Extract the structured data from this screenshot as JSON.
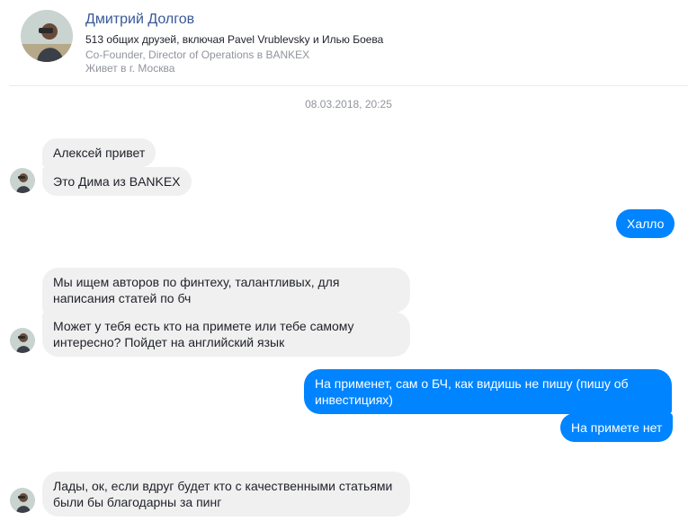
{
  "profile": {
    "name": "Дмитрий Долгов",
    "mutual_friends": "513 общих друзей, включая Pavel Vrublevsky и Илью Боева",
    "job": "Co-Founder, Director of Operations в BANKEX",
    "city": "Живет в г. Москва"
  },
  "conversation": {
    "timestamp": "08.03.2018, 20:25",
    "messages": [
      {
        "text": "Алексей привет",
        "direction": "incoming"
      },
      {
        "text": "Это Дима из BANKEX",
        "direction": "incoming"
      },
      {
        "text": "Халло",
        "direction": "outgoing"
      },
      {
        "text": "Мы ищем авторов по финтеху, талантливых, для написания статей по бч",
        "direction": "incoming"
      },
      {
        "text": "Может у тебя есть кто на примете или тебе самому интересно?  Пойдет на английский язык",
        "direction": "incoming"
      },
      {
        "text": "На применет, сам о БЧ, как видишь не пишу (пишу об инвестициях)",
        "direction": "outgoing"
      },
      {
        "text": "На примете нет",
        "direction": "outgoing"
      },
      {
        "text": "Лады, ок, если вдруг будет кто с качественными статьями были бы благодарны за пинг",
        "direction": "incoming"
      }
    ]
  },
  "colors": {
    "outgoing_bubble": "#0084ff",
    "incoming_bubble": "#f1f0f0",
    "name_link": "#385898",
    "muted_text": "#90949c"
  }
}
